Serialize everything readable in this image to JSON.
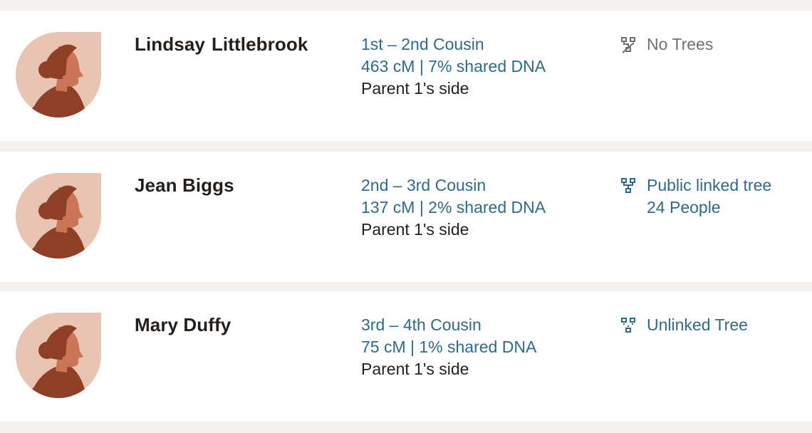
{
  "matches": [
    {
      "first_name": "Lindsay",
      "last_name": "Littlebrook",
      "relationship": "1st – 2nd Cousin",
      "shared_dna": "463 cM | 7% shared DNA",
      "side": "Parent 1's side",
      "tree_icon": "no-tree-icon",
      "tree_status": "No Trees",
      "tree_people": ""
    },
    {
      "name": "Jean Biggs",
      "relationship": "2nd – 3rd Cousin",
      "shared_dna": "137 cM | 2% shared DNA",
      "side": "Parent 1's side",
      "tree_icon": "linked-tree-icon",
      "tree_status": "Public linked tree",
      "tree_people": "24 People"
    },
    {
      "name": "Mary Duffy",
      "relationship": "3rd – 4th Cousin",
      "shared_dna": "75 cM | 1% shared DNA",
      "side": "Parent 1's side",
      "tree_icon": "unlinked-tree-icon",
      "tree_status": "Unlinked Tree",
      "tree_people": ""
    }
  ],
  "colors": {
    "page_background": "#f5f1ee",
    "card_background": "#ffffff",
    "link_blue": "#2e6a8a",
    "text_dark": "#231f1c",
    "muted_gray": "#6f6f6f",
    "avatar_background": "#e9c4b2",
    "avatar_skin": "#c97556",
    "avatar_hair": "#8f3f25"
  }
}
